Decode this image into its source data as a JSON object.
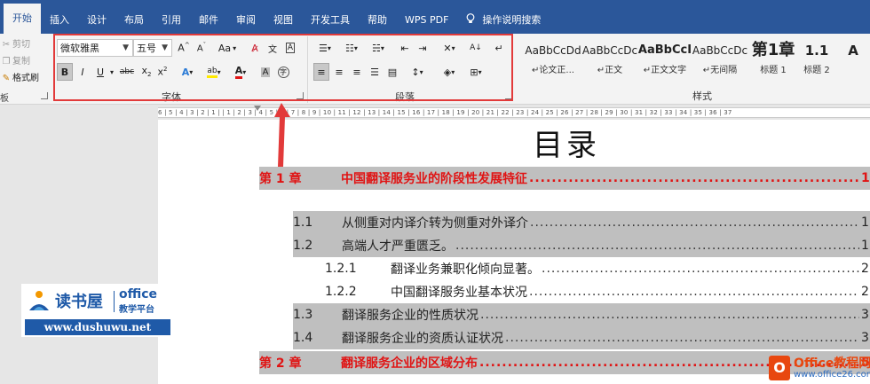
{
  "tabs": [
    {
      "label": "开始",
      "active": true
    },
    {
      "label": "插入"
    },
    {
      "label": "设计"
    },
    {
      "label": "布局"
    },
    {
      "label": "引用"
    },
    {
      "label": "邮件"
    },
    {
      "label": "审阅"
    },
    {
      "label": "视图"
    },
    {
      "label": "开发工具"
    },
    {
      "label": "帮助"
    },
    {
      "label": "WPS PDF"
    },
    {
      "label": "操作说明搜索"
    }
  ],
  "clipboard": {
    "cut": "剪切",
    "copy": "复制",
    "format_painter": "格式刷",
    "group_label": "板"
  },
  "font": {
    "font_name": "微软雅黑",
    "font_size": "五号",
    "change_case": "Aa",
    "group_label": "字体"
  },
  "paragraph": {
    "group_label": "段落"
  },
  "styles": {
    "group_label": "样式",
    "items": [
      {
        "preview": "AaBbCcDd",
        "name": "↵论文正..."
      },
      {
        "preview": "AaBbCcDc",
        "name": "↵正文"
      },
      {
        "preview": "AaBbCcI",
        "name": "↵正文文字"
      },
      {
        "preview": "AaBbCcDc",
        "name": "↵无间隔"
      },
      {
        "preview": "第1章",
        "name": "标题 1"
      },
      {
        "preview": "1.1",
        "name": "标题 2"
      },
      {
        "preview": "A",
        "name": ""
      }
    ]
  },
  "ruler": {
    "numbers": "6 | 5 | 4 | 3 | 2 | 1 |     | 1 | 2 | 3 | 4 | 5 | 6 | 7 | 8 | 9 | 10 | 11 | 12 | 13 | 14 | 15 | 16 | 17 | 18 | 19 | 20 | 21 | 22 | 23 | 24 | 25 | 26 | 27 | 28 | 29 | 30 | 31 | 32 | 33 | 34 | 35 | 36 | 37"
  },
  "document": {
    "title": "目录",
    "toc": [
      {
        "num": "第 1 章",
        "title": "中国翻译服务业的阶段性发展特征",
        "page": "1",
        "level": "chapter"
      },
      {
        "num": "1.1",
        "title": "从侧重对内译介转为侧重对外译介",
        "page": "1",
        "level": "1"
      },
      {
        "num": "1.2",
        "title": "高端人才严重匮乏。",
        "page": "1",
        "level": "1"
      },
      {
        "num": "1.2.1",
        "title": "翻译业务兼职化倾向显著。",
        "page": "2",
        "level": "2"
      },
      {
        "num": "1.2.2",
        "title": "中国翻译服务业基本状况",
        "page": "2",
        "level": "2"
      },
      {
        "num": "1.3",
        "title": "翻译服务企业的性质状况",
        "page": "3",
        "level": "1"
      },
      {
        "num": "1.4",
        "title": "翻译服务企业的资质认证状况",
        "page": "3",
        "level": "1"
      },
      {
        "num": "第 2 章",
        "title": "翻译服务企业的区域分布",
        "page": "5",
        "level": "chapter"
      }
    ]
  },
  "watermark": {
    "brand": "读书屋",
    "office": "office",
    "platform": "教学平台",
    "url": "www.dushuwu.net"
  },
  "watermark2": {
    "title": "Office教程网",
    "url": "www.office26.com"
  }
}
